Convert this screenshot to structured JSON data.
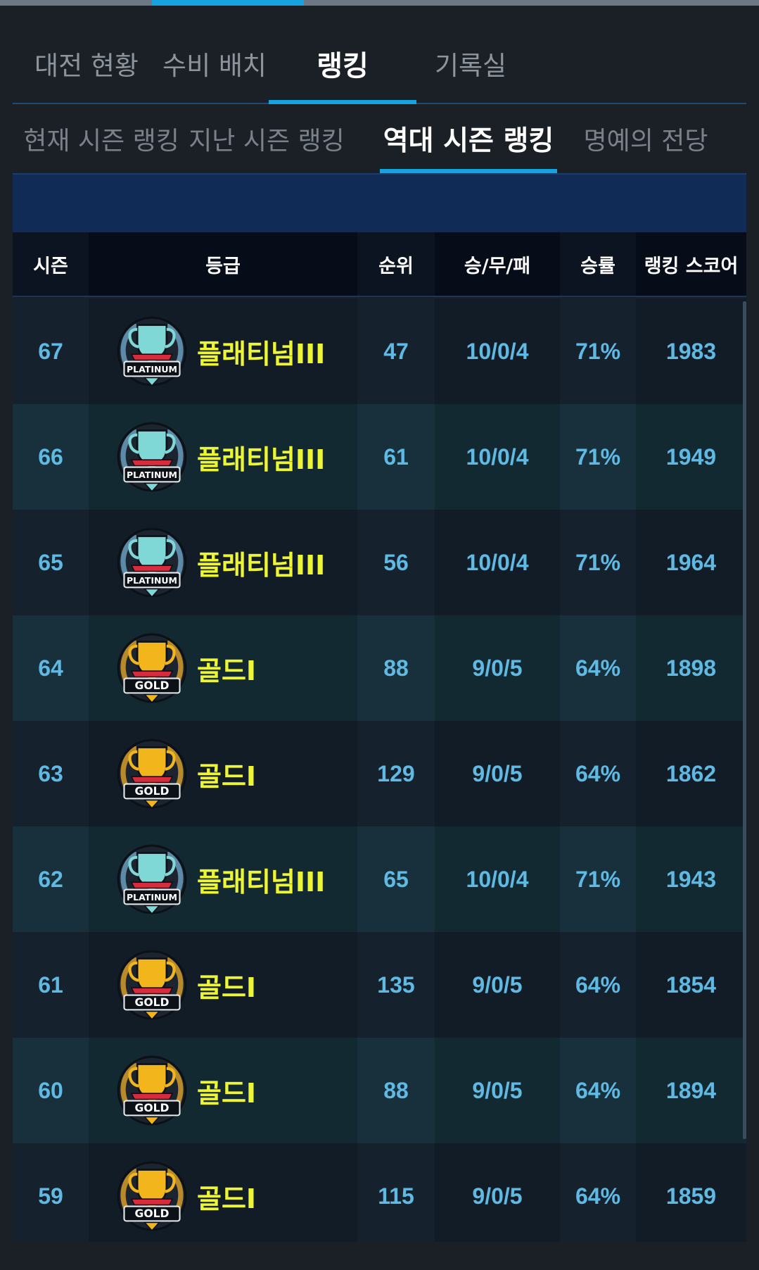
{
  "main_tabs": [
    {
      "label": "대전 현황",
      "active": false
    },
    {
      "label": "수비 배치",
      "active": false
    },
    {
      "label": "랭킹",
      "active": true
    },
    {
      "label": "기록실",
      "active": false
    }
  ],
  "sub_tabs": [
    {
      "label": "현재 시즌 랭킹",
      "active": false
    },
    {
      "label": "지난 시즌 랭킹",
      "active": false
    },
    {
      "label": "역대 시즌 랭킹",
      "active": true
    },
    {
      "label": "명예의 전당",
      "active": false
    }
  ],
  "table": {
    "headers": [
      "시즌",
      "등급",
      "순위",
      "승/무/패",
      "승률",
      "랭킹 스코어"
    ],
    "rows": [
      {
        "season": "67",
        "grade": "플래티넘III",
        "badge": "platinum",
        "rank": "47",
        "record": "10/0/4",
        "win_rate": "71%",
        "score": "1983"
      },
      {
        "season": "66",
        "grade": "플래티넘III",
        "badge": "platinum",
        "rank": "61",
        "record": "10/0/4",
        "win_rate": "71%",
        "score": "1949"
      },
      {
        "season": "65",
        "grade": "플래티넘III",
        "badge": "platinum",
        "rank": "56",
        "record": "10/0/4",
        "win_rate": "71%",
        "score": "1964"
      },
      {
        "season": "64",
        "grade": "골드I",
        "badge": "gold",
        "rank": "88",
        "record": "9/0/5",
        "win_rate": "64%",
        "score": "1898"
      },
      {
        "season": "63",
        "grade": "골드I",
        "badge": "gold",
        "rank": "129",
        "record": "9/0/5",
        "win_rate": "64%",
        "score": "1862"
      },
      {
        "season": "62",
        "grade": "플래티넘III",
        "badge": "platinum",
        "rank": "65",
        "record": "10/0/4",
        "win_rate": "71%",
        "score": "1943"
      },
      {
        "season": "61",
        "grade": "골드I",
        "badge": "gold",
        "rank": "135",
        "record": "9/0/5",
        "win_rate": "64%",
        "score": "1854"
      },
      {
        "season": "60",
        "grade": "골드I",
        "badge": "gold",
        "rank": "88",
        "record": "9/0/5",
        "win_rate": "64%",
        "score": "1894"
      },
      {
        "season": "59",
        "grade": "골드I",
        "badge": "gold",
        "rank": "115",
        "record": "9/0/5",
        "win_rate": "64%",
        "score": "1859"
      }
    ]
  },
  "badges": {
    "platinum": {
      "text": "PLATINUM",
      "icon": "platinum-trophy-icon",
      "cup": "#7fd8d6",
      "laurel": "#5d8aa6",
      "ribbon": "#d92b3e"
    },
    "gold": {
      "text": "GOLD",
      "icon": "gold-trophy-icon",
      "cup": "#f2b61c",
      "laurel": "#b88a2a",
      "ribbon": "#d92b3e"
    }
  },
  "colors": {
    "accent": "#17a3e0",
    "grade_text": "#eef533",
    "cell_text": "#5fb9e3",
    "banner": "#102b56"
  }
}
